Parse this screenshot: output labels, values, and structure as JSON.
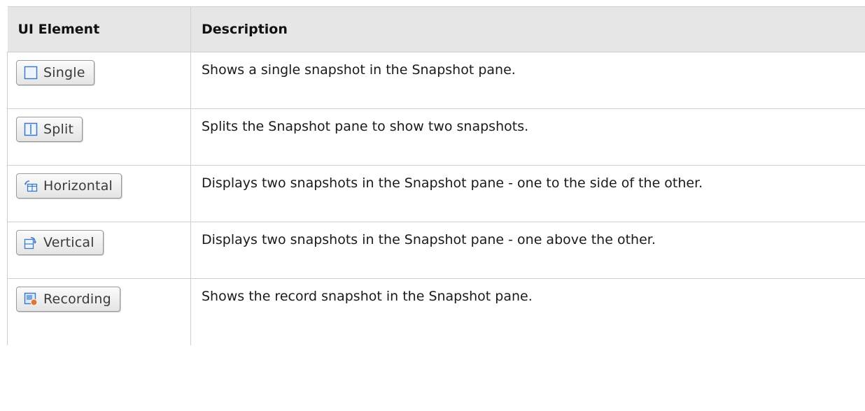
{
  "table": {
    "headers": {
      "ui_element": "UI Element",
      "description": "Description"
    },
    "rows": [
      {
        "button_label": "Single",
        "icon": "single-pane-icon",
        "description": "Shows a single snapshot in the Snapshot pane."
      },
      {
        "button_label": "Split",
        "icon": "split-pane-icon",
        "description": "Splits the Snapshot pane to show two snapshots."
      },
      {
        "button_label": "Horizontal",
        "icon": "horizontal-layout-icon",
        "description": "Displays two snapshots in the Snapshot pane - one to the side of the other."
      },
      {
        "button_label": "Vertical",
        "icon": "vertical-layout-icon",
        "description": "Displays two snapshots in the Snapshot pane - one above the other."
      },
      {
        "button_label": "Recording",
        "icon": "recording-snapshot-icon",
        "description": "Shows the record snapshot in the Snapshot pane."
      }
    ]
  },
  "colors": {
    "icon_blue": "#3a78c8",
    "record_orange": "#e8733a"
  }
}
